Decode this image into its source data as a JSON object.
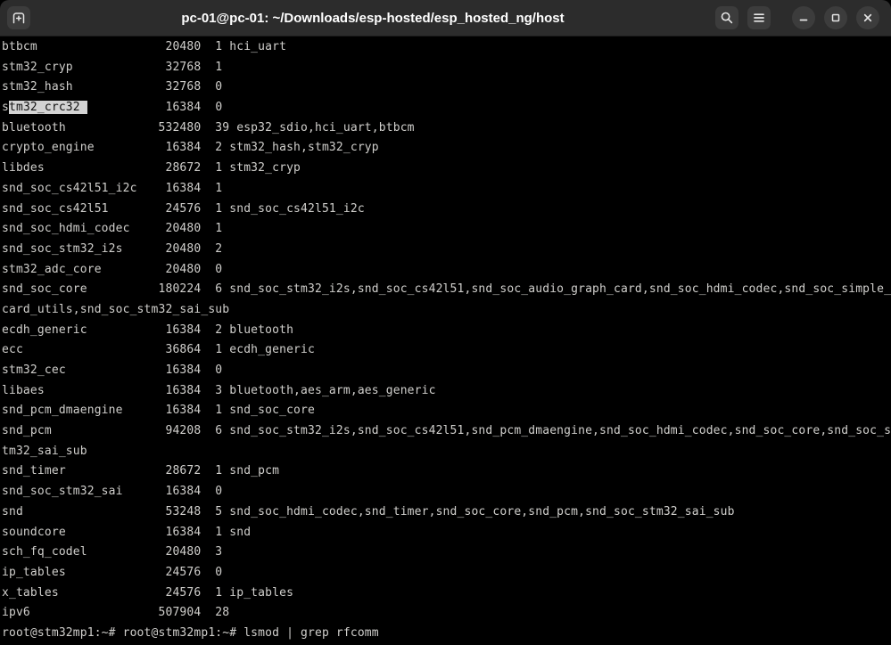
{
  "window": {
    "title": "pc-01@pc-01: ~/Downloads/esp-hosted/esp_hosted_ng/host",
    "icons": {
      "new_tab": "tab-plus",
      "search": "magnifier",
      "menu": "hamburger",
      "minimize": "dash",
      "maximize": "square-outline",
      "close": "cross"
    }
  },
  "terminal": {
    "columns": 125,
    "colors": {
      "background": "#000000",
      "foreground": "#d0cfcc",
      "selection_bg": "#d3d3d3",
      "selection_fg": "#111111"
    },
    "modules": [
      {
        "name": "btbcm",
        "size": 20480,
        "used": 1,
        "by": "hci_uart"
      },
      {
        "name": "stm32_cryp",
        "size": 32768,
        "used": 1,
        "by": ""
      },
      {
        "name": "stm32_hash",
        "size": 32768,
        "used": 0,
        "by": ""
      },
      {
        "name": "stm32_crc32",
        "size": 16384,
        "used": 0,
        "by": "",
        "selection": {
          "start": 1,
          "length": 11
        }
      },
      {
        "name": "bluetooth",
        "size": 532480,
        "used": 39,
        "by": "esp32_sdio,hci_uart,btbcm"
      },
      {
        "name": "crypto_engine",
        "size": 16384,
        "used": 2,
        "by": "stm32_hash,stm32_cryp"
      },
      {
        "name": "libdes",
        "size": 28672,
        "used": 1,
        "by": "stm32_cryp"
      },
      {
        "name": "snd_soc_cs42l51_i2c",
        "size": 16384,
        "used": 1,
        "by": ""
      },
      {
        "name": "snd_soc_cs42l51",
        "size": 24576,
        "used": 1,
        "by": "snd_soc_cs42l51_i2c"
      },
      {
        "name": "snd_soc_hdmi_codec",
        "size": 20480,
        "used": 1,
        "by": ""
      },
      {
        "name": "snd_soc_stm32_i2s",
        "size": 20480,
        "used": 2,
        "by": ""
      },
      {
        "name": "stm32_adc_core",
        "size": 20480,
        "used": 0,
        "by": ""
      },
      {
        "name": "snd_soc_core",
        "size": 180224,
        "used": 6,
        "by": "snd_soc_stm32_i2s,snd_soc_cs42l51,snd_soc_audio_graph_card,snd_soc_hdmi_codec,snd_soc_simple_card_utils,snd_soc_stm32_sai_sub"
      },
      {
        "name": "ecdh_generic",
        "size": 16384,
        "used": 2,
        "by": "bluetooth"
      },
      {
        "name": "ecc",
        "size": 36864,
        "used": 1,
        "by": "ecdh_generic"
      },
      {
        "name": "stm32_cec",
        "size": 16384,
        "used": 0,
        "by": ""
      },
      {
        "name": "libaes",
        "size": 16384,
        "used": 3,
        "by": "bluetooth,aes_arm,aes_generic"
      },
      {
        "name": "snd_pcm_dmaengine",
        "size": 16384,
        "used": 1,
        "by": "snd_soc_core"
      },
      {
        "name": "snd_pcm",
        "size": 94208,
        "used": 6,
        "by": "snd_soc_stm32_i2s,snd_soc_cs42l51,snd_pcm_dmaengine,snd_soc_hdmi_codec,snd_soc_core,snd_soc_stm32_sai_sub"
      },
      {
        "name": "snd_timer",
        "size": 28672,
        "used": 1,
        "by": "snd_pcm"
      },
      {
        "name": "snd_soc_stm32_sai",
        "size": 16384,
        "used": 0,
        "by": ""
      },
      {
        "name": "snd",
        "size": 53248,
        "used": 5,
        "by": "snd_soc_hdmi_codec,snd_timer,snd_soc_core,snd_pcm,snd_soc_stm32_sai_sub"
      },
      {
        "name": "soundcore",
        "size": 16384,
        "used": 1,
        "by": "snd"
      },
      {
        "name": "sch_fq_codel",
        "size": 20480,
        "used": 3,
        "by": ""
      },
      {
        "name": "ip_tables",
        "size": 24576,
        "used": 0,
        "by": ""
      },
      {
        "name": "x_tables",
        "size": 24576,
        "used": 1,
        "by": "ip_tables"
      },
      {
        "name": "ipv6",
        "size": 507904,
        "used": 28,
        "by": ""
      }
    ],
    "prompt_line": "root@stm32mp1:~# root@stm32mp1:~# lsmod | grep rfcomm"
  }
}
